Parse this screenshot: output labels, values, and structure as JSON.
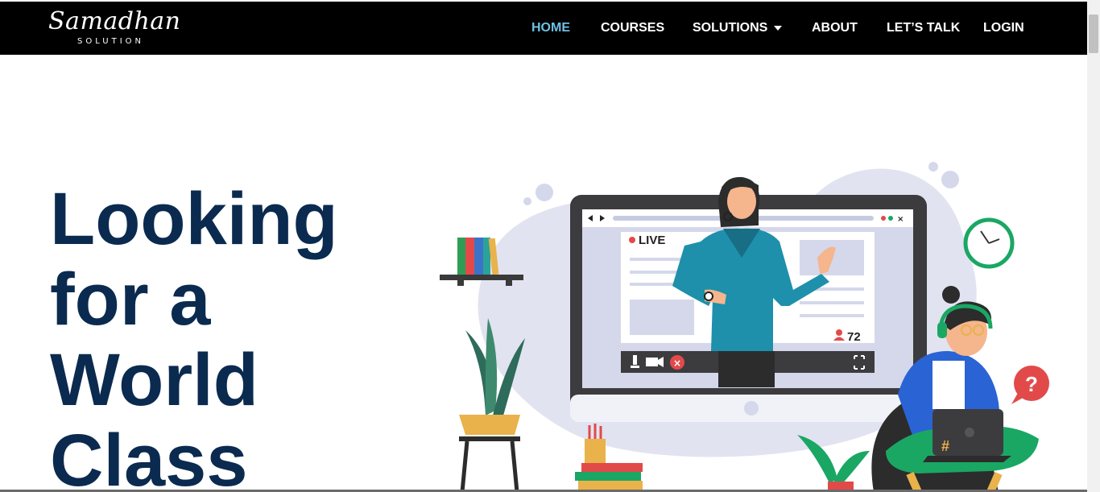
{
  "logo": {
    "script": "Samadhan",
    "sub": "SOLUTION"
  },
  "nav": {
    "home": "HOME",
    "courses": "COURSES",
    "solutions": "SOLUTIONS",
    "about": "ABOUT",
    "lets_talk": "LET’S TALK",
    "login": "LOGIN"
  },
  "hero": {
    "line1": "Looking",
    "line2": "for a",
    "line3": "World",
    "line4": "Class"
  },
  "illustration": {
    "live_label": "LIVE",
    "viewer_count": "72",
    "help_icon": "?",
    "laptop_symbol": "#",
    "icons": [
      "clock-icon",
      "help-bubble-icon",
      "video-camera-icon",
      "close-icon",
      "expand-icon",
      "user-icon"
    ]
  },
  "colors": {
    "nav_bg": "#000000",
    "nav_active": "#6ec1e4",
    "hero_text": "#0b2a4f",
    "accent_red": "#e24a4a",
    "teal": "#1e90ab",
    "green": "#1aa764"
  }
}
